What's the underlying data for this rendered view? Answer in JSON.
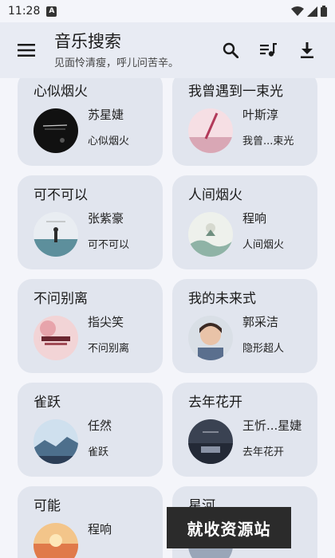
{
  "status_bar": {
    "time": "11:28",
    "notification_glyph": "A"
  },
  "app_bar": {
    "title": "音乐搜索",
    "subtitle": "见面怜清瘦，呼儿问苦辛。"
  },
  "icons": {
    "menu": "menu-icon",
    "search": "search-icon",
    "playlist": "playlist-icon",
    "download": "download-icon"
  },
  "songs": [
    {
      "title": "心似烟火",
      "singer": "苏星婕",
      "album": "心似烟火"
    },
    {
      "title": "我曾遇到一束光",
      "singer": "叶斯淳",
      "album": "我曾...束光"
    },
    {
      "title": "可不可以",
      "singer": "张紫豪",
      "album": "可不可以"
    },
    {
      "title": "人间烟火",
      "singer": "程响",
      "album": "人间烟火"
    },
    {
      "title": "不问别离",
      "singer": "指尖笑",
      "album": "不问别离"
    },
    {
      "title": "我的未来式",
      "singer": "郭采洁",
      "album": "隐形超人"
    },
    {
      "title": "雀跃",
      "singer": "任然",
      "album": "雀跃"
    },
    {
      "title": "去年花开",
      "singer": "王忻...星婕",
      "album": "去年花开"
    },
    {
      "title": "可能",
      "singer": "程响",
      "album": ""
    },
    {
      "title": "星河",
      "singer": "",
      "album": ""
    }
  ],
  "watermark": "就收资源站",
  "colors": {
    "app_bar": "#e8ebf3",
    "card": "#e1e5ee",
    "background": "#f4f5fa"
  }
}
